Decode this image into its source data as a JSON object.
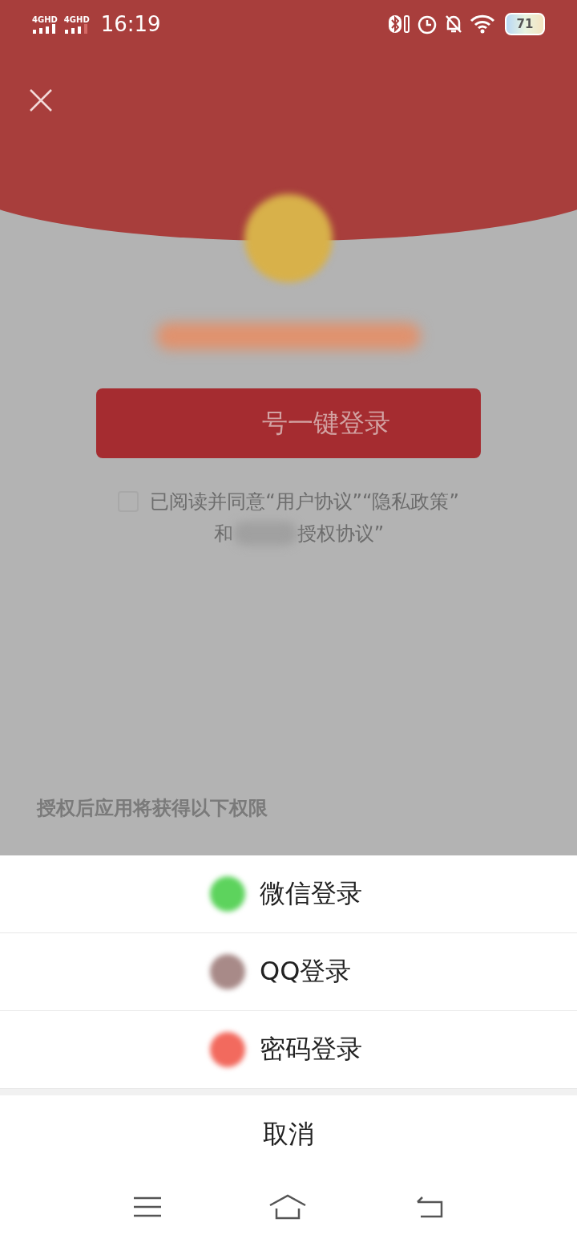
{
  "status_bar": {
    "networks": [
      "4GHD",
      "4GHD"
    ],
    "time": "16:19",
    "battery": "71"
  },
  "login": {
    "button": "号一键登录",
    "agreement": {
      "checked": false,
      "line_1": "已阅读并同意“用户协议”“隐私政策”",
      "line_2_start": "和",
      "line_2_end": "授权协议”"
    },
    "permissions_title": "授权后应用将获得以下权限"
  },
  "sheet": {
    "options": [
      {
        "label": "微信登录",
        "color": "#5dd35d"
      },
      {
        "label": "QQ登录",
        "color": "#a88a88"
      },
      {
        "label": "密码登录",
        "color": "#f26a5e"
      }
    ],
    "cancel": "取消"
  }
}
